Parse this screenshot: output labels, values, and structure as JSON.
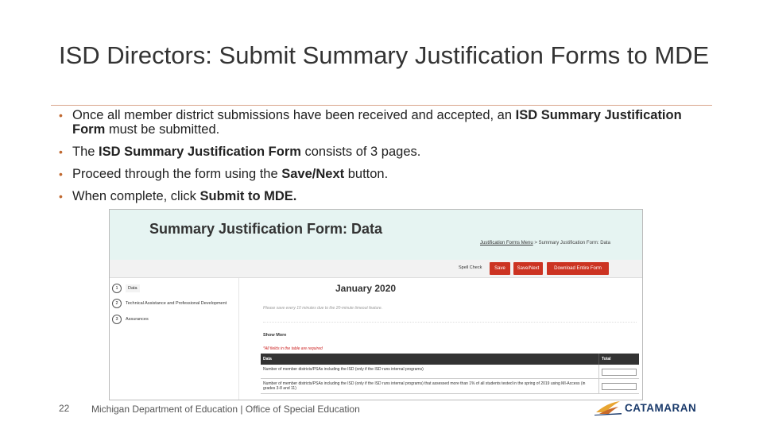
{
  "slide": {
    "title": "ISD Directors: Submit Summary Justification Forms to MDE",
    "bullets": [
      {
        "pre": "Once all member district submissions have been received and accepted, an ",
        "bold": "ISD Summary Justification Form",
        "post": " must be submitted."
      },
      {
        "pre": "The ",
        "bold": "ISD Summary Justification Form",
        "post": " consists of 3 pages."
      },
      {
        "pre": "Proceed through the form using the ",
        "bold": "Save/Next",
        "post": " button."
      },
      {
        "pre": "When complete, click ",
        "bold": "Submit to MDE.",
        "post": ""
      }
    ],
    "page_number": "22",
    "footer": "Michigan Department of Education | Office of Special Education",
    "logo_text": "CATAMARAN"
  },
  "screenshot": {
    "form_title": "Summary Justification Form: Data",
    "breadcrumb": {
      "link": "Justification Forms Menu",
      "separator": ">",
      "current": "Summary Justification Form: Data"
    },
    "toolbar": {
      "spell_check": "Spell Check",
      "save": "Save",
      "save_next": "Save/Next",
      "download": "Download Entire Form"
    },
    "steps": [
      {
        "num": "1",
        "label": "Data"
      },
      {
        "num": "2",
        "label": "Technical Assistance and Professional Development"
      },
      {
        "num": "3",
        "label": "Assurances"
      }
    ],
    "month": "January 2020",
    "note": "Please save every 10 minutes due to the 20-minute timeout feature.",
    "show_more": "Show More",
    "required_note": "*All fields in the table are required",
    "table": {
      "headers": [
        "Data",
        "Total"
      ],
      "rows": [
        "Number of member districts/PSAs including the ISD (only if the ISD runs internal programs)",
        "Number of member districts/PSAs including the ISD (only if the ISD runs internal programs) that assessed more than 1% of all students tested in the spring of 2019 using MI-Access (in grades 3-8 and 11)"
      ]
    }
  },
  "colors": {
    "accent": "#c0682f",
    "header_bg": "#e6f4f2",
    "button_red": "#cc3322",
    "logo_blue": "#1a3a6b"
  }
}
